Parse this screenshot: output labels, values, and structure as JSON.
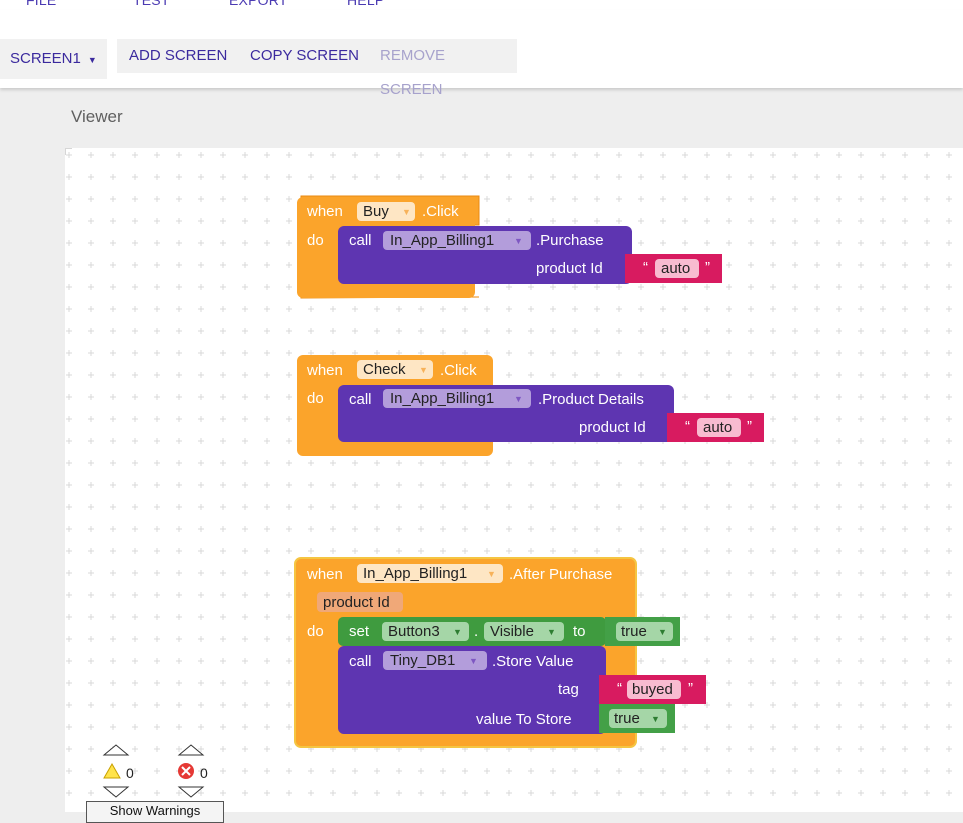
{
  "menu": {
    "items": [
      "FILE",
      "TEST",
      "EXPORT",
      "HELP"
    ]
  },
  "toolbar": {
    "screen_select": "SCREEN1",
    "add_screen": "ADD SCREEN",
    "copy_screen": "COPY SCREEN",
    "remove_screen": "REMOVE SCREEN"
  },
  "viewer": {
    "title": "Viewer"
  },
  "colors": {
    "event": "#fba42b",
    "method": "#5e35b1",
    "text": "#d81b60",
    "setter": "#3f9b3f",
    "logic": "#43a047"
  },
  "blocks": {
    "buy": {
      "when": "when",
      "component": "Buy",
      "event": ".Click",
      "do": "do",
      "call": "call",
      "target": "In_App_Billing1",
      "method": ".Purchase",
      "param": "product Id",
      "quote_open": "“",
      "value": "auto",
      "quote_close": "”"
    },
    "check": {
      "when": "when",
      "component": "Check",
      "event": ".Click",
      "do": "do",
      "call": "call",
      "target": "In_App_Billing1",
      "method": ".Product Details",
      "param": "product Id",
      "quote_open": "“",
      "value": "auto",
      "quote_close": "”"
    },
    "after": {
      "when": "when",
      "component": "In_App_Billing1",
      "event": ".After Purchase",
      "local_param": "product Id",
      "do": "do",
      "set": "set",
      "set_component": "Button3",
      "dot": ".",
      "set_property": "Visible",
      "to": "to",
      "set_value": "true",
      "call": "call",
      "target": "Tiny_DB1",
      "method": ".Store Value",
      "tag_label": "tag",
      "tag_quote_open": "“",
      "tag_value": "buyed",
      "tag_quote_close": "”",
      "store_label": "value To Store",
      "store_value": "true"
    }
  },
  "indicators": {
    "warning_count": "0",
    "error_count": "0",
    "show_warnings": "Show Warnings"
  }
}
